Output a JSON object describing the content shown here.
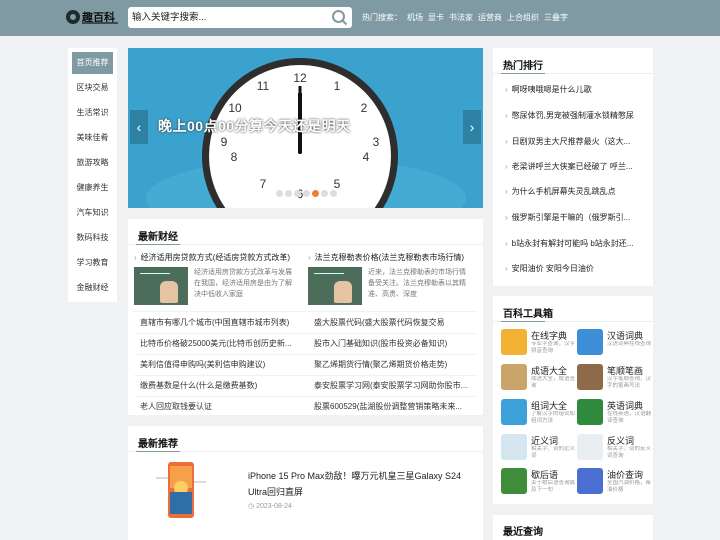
{
  "header": {
    "logo_text": "趣百科",
    "search_placeholder": "输入关键字搜索...",
    "hot_label": "热门搜索：",
    "hot_links": [
      "机场",
      "显卡",
      "书法家",
      "运营商",
      "上合组织",
      "三叠字"
    ]
  },
  "sidebar": {
    "items": [
      "首页推荐",
      "区块交易",
      "生活常识",
      "美味佳肴",
      "旅游攻略",
      "健康养生",
      "汽车知识",
      "数码科技",
      "学习教育",
      "金融财经"
    ]
  },
  "banner": {
    "caption": "晚上00点00分算今天还是明天",
    "clock_numbers": [
      "12",
      "11",
      "1",
      "10",
      "2",
      "9",
      "3",
      "8",
      "4",
      "7",
      "6",
      "5"
    ]
  },
  "finance": {
    "title": "最新财经",
    "featured": [
      {
        "headline": "经济适用房贷款方式(经适房贷款方式改革)",
        "desc": "经济适用房贷款方式改革与发展在我国，经济适用房是由为了解决中低收入家庭"
      },
      {
        "headline": "法兰克穆勒表价格(法兰克穆勒表市场行情)",
        "desc": "近来，法兰克穆勒表的市场行情备受关注。法兰克穆勒表以其精准、高贵、深度"
      }
    ],
    "left_list": [
      "直辖市有哪几个城市(中国直辖市城市列表)",
      "比特币价格破25000美元(比特币创历史新...",
      "美利信值得申购吗(美利信申购建议)",
      "缴费基数是什么(什么是缴费基数)",
      "老人回应取钱要认证"
    ],
    "right_list": [
      "盛大股票代码(盛大股票代码恢复交易",
      "股市入门基础知识(股市投资必备知识)",
      "聚乙烯期货行情(聚乙烯期货价格走势)",
      "泰安股票学习网(泰安股票学习网助你股市...",
      "股票600529(盐湖股份调整营销策略未来..."
    ]
  },
  "recommend": {
    "title": "最新推荐",
    "headline": "iPhone 15 Pro Max劲敌！曝万元机皇三星Galaxy S24 Ultra回归直屏",
    "date": "2023-08-24"
  },
  "hot_rank": {
    "title": "热门排行",
    "items": [
      "啊呀咦哦嗯是什么儿歌",
      "憋尿体罚,男宠被强制灌水锁精憋尿",
      "日剧双男主大尺推荐最火（这大...",
      "老梁讲呼兰大侠案已经破了 呼兰...",
      "为什么手机屏幕失灵乱跳乱点",
      "俄罗斯引擎是干嘛的（俄罗斯引...",
      "b站永封有解封可能吗 b站永封还...",
      "安阳油价 安阳今日油价"
    ]
  },
  "tools": {
    "title": "百科工具箱",
    "items": [
      {
        "name": "在线字典",
        "desc": "专业字查询，汉字拼音查询",
        "color": "#f2b233"
      },
      {
        "name": "汉语词典",
        "desc": "汉语词典在线查询",
        "color": "#3c8fd6"
      },
      {
        "name": "成语大全",
        "desc": "成语大全，成语查询",
        "color": "#c9a56b"
      },
      {
        "name": "笔顺笔画",
        "desc": "汉字笔顺查询，汉字的笔画写法",
        "color": "#8c6a4a"
      },
      {
        "name": "组词大全",
        "desc": "了解汉字的组词和组词方法",
        "color": "#3ea0d8"
      },
      {
        "name": "英语词典",
        "desc": "在线英语，汉语翻译查询",
        "color": "#2f8a3e"
      },
      {
        "name": "近义词",
        "desc": "相关字、词的近义词",
        "color": "#d6e6f0"
      },
      {
        "name": "反义词",
        "desc": "相关字、词的反义词查询",
        "color": "#e9eef2"
      },
      {
        "name": "歇后语",
        "desc": "关于歇后语查询篇及下一句",
        "color": "#3f8c3a"
      },
      {
        "name": "油价查询",
        "desc": "全国汽油价格，柴油价格",
        "color": "#4a6fd0"
      }
    ]
  },
  "recent": {
    "title": "最近查询"
  },
  "colors": {
    "header_bg": "#7f9aa3",
    "banner_bg": "#3aa2cc",
    "active_nav": "#7f9aa3"
  }
}
